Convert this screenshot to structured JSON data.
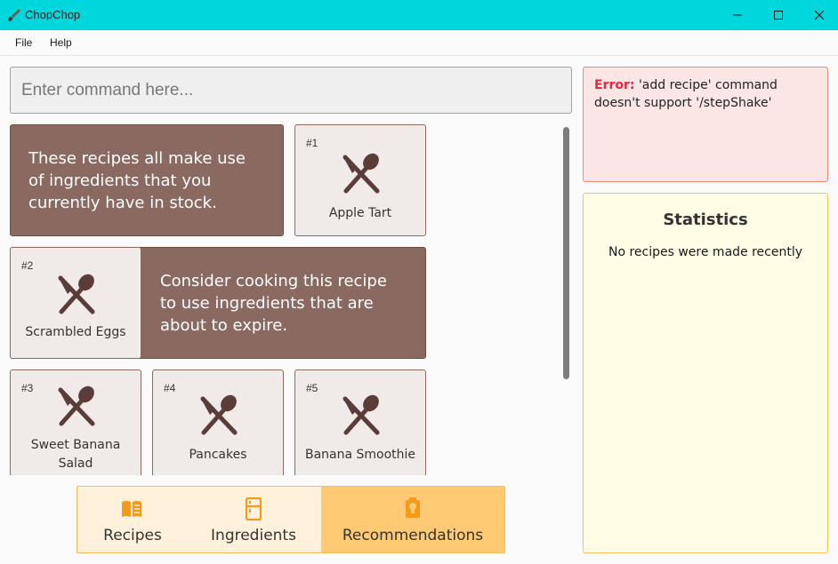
{
  "window": {
    "title": "ChopChop"
  },
  "menu": [
    {
      "label": "File"
    },
    {
      "label": "Help"
    }
  ],
  "command": {
    "placeholder": "Enter command here...",
    "value": ""
  },
  "recipe_list": {
    "in_stock_message": "These recipes all make use of ingredients that you currently have in stock.",
    "expiring_message": "Consider cooking this recipe to use ingredients that are about to expire.",
    "cards": [
      {
        "index": "#1",
        "name": "Apple Tart"
      },
      {
        "index": "#2",
        "name": "Scrambled Eggs"
      },
      {
        "index": "#3",
        "name": "Sweet Banana Salad"
      },
      {
        "index": "#4",
        "name": "Pancakes"
      },
      {
        "index": "#5",
        "name": "Banana Smoothie"
      }
    ]
  },
  "tabs": [
    {
      "label": "Recipes",
      "icon": "book-icon",
      "active": false
    },
    {
      "label": "Ingredients",
      "icon": "fridge-icon",
      "active": false
    },
    {
      "label": "Recommendations",
      "icon": "lightbulb-icon",
      "active": true
    }
  ],
  "error": {
    "label": "Error:",
    "message": "'add recipe' command doesn't support '/stepShake'"
  },
  "statistics": {
    "title": "Statistics",
    "empty_text": "No recipes were made recently"
  },
  "colors": {
    "titlebar": "#00d7dc",
    "message_bg": "#8a6a60",
    "card_bg": "#f0ebe8",
    "utensil": "#5a3d38",
    "tab_bg": "#fff1db",
    "tab_active": "#ffca73",
    "tab_icon": "#f39a1c",
    "error_bg": "#fbe5e5",
    "error_label": "#e8243e",
    "stats_bg": "#fffce6"
  }
}
